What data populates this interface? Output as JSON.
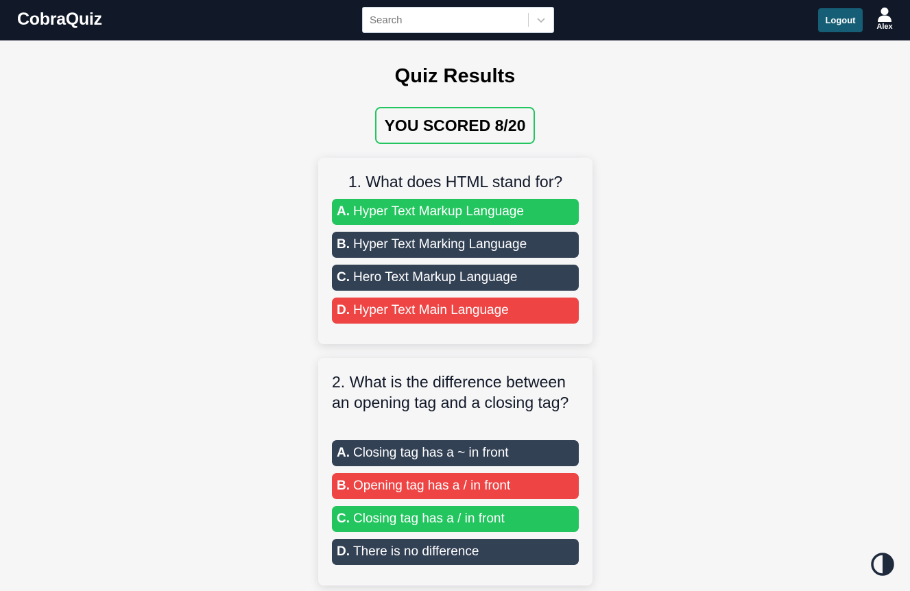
{
  "header": {
    "brand": "CobraQuiz",
    "search_placeholder": "Search",
    "logout_label": "Logout",
    "username": "Alex"
  },
  "page": {
    "title": "Quiz Results",
    "score_text": "YOU SCORED 8/20"
  },
  "questions": [
    {
      "text": "1. What does HTML stand for?",
      "options": [
        {
          "letter": "A.",
          "text": "Hyper Text Markup Language",
          "state": "correct"
        },
        {
          "letter": "B.",
          "text": "Hyper Text Marking Language",
          "state": "neutral"
        },
        {
          "letter": "C.",
          "text": "Hero Text Markup Language",
          "state": "neutral"
        },
        {
          "letter": "D.",
          "text": "Hyper Text Main Language",
          "state": "wrong"
        }
      ]
    },
    {
      "text": "2. What is the difference between an opening tag and a closing tag?",
      "options": [
        {
          "letter": "A.",
          "text": "Closing tag has a ~ in front",
          "state": "neutral"
        },
        {
          "letter": "B.",
          "text": "Opening tag has a / in front",
          "state": "wrong"
        },
        {
          "letter": "C.",
          "text": "Closing tag has a / in front",
          "state": "correct"
        },
        {
          "letter": "D.",
          "text": "There is no difference",
          "state": "neutral"
        }
      ]
    }
  ],
  "colors": {
    "navbar": "#111827",
    "correct": "#22c55e",
    "wrong": "#ef4444",
    "neutral": "#334155",
    "logout": "#155e75"
  },
  "icons": {
    "dropdown": "chevron-down-icon",
    "user": "user-icon",
    "theme": "contrast-icon"
  }
}
